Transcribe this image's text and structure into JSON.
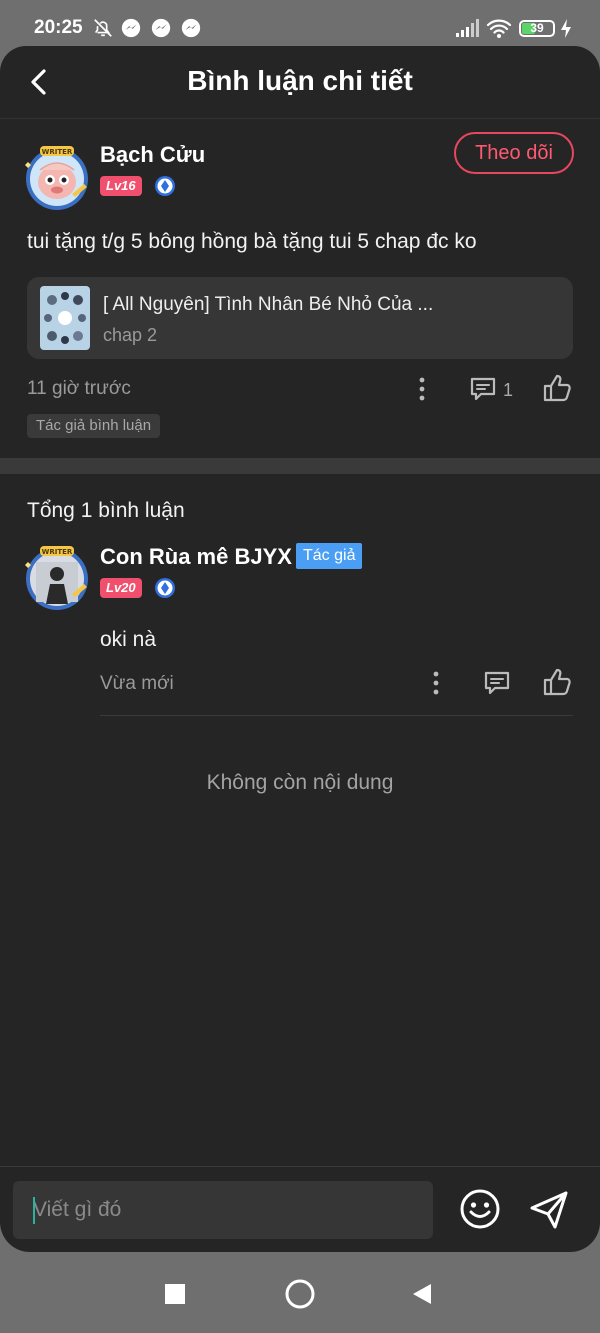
{
  "status_bar": {
    "time": "20:25",
    "battery": "39"
  },
  "header": {
    "title": "Bình luận chi tiết"
  },
  "main_comment": {
    "author": "Bạch Cửu",
    "level": "Lv16",
    "follow_label": "Theo dõi",
    "text": "tui tặng t/g 5 bông hồng bà tặng tui 5 chap đc ko",
    "story": {
      "title": "[ All Nguyên] Tình Nhân Bé Nhỏ Của ...",
      "chapter": "chap 2"
    },
    "time": "11 giờ trước",
    "reply_count": "1",
    "tag": "Tác giả bình luận",
    "avatar_frame_text": "WRITER"
  },
  "replies_section": {
    "total_label": "Tổng 1 bình luận",
    "replies": [
      {
        "author": "Con Rùa mê BJYX",
        "author_badge": "Tác giả",
        "level": "Lv20",
        "text": "oki nà",
        "time": "Vừa mới",
        "avatar_frame_text": "WRITER"
      }
    ],
    "end_label": "Không còn nội dung"
  },
  "input": {
    "placeholder": "Viết gì đó"
  },
  "icons": {
    "back": "chevron-left-icon",
    "more": "more-vertical-icon",
    "reply": "comment-icon",
    "like": "thumbs-up-icon",
    "emoji": "smile-icon",
    "send": "send-icon",
    "level_badge": "diamond-badge-icon"
  },
  "colors": {
    "background": "#252525",
    "accent_pink": "#f0506e",
    "author_blue": "#4a9ff5",
    "caret_teal": "#2ab29f"
  }
}
